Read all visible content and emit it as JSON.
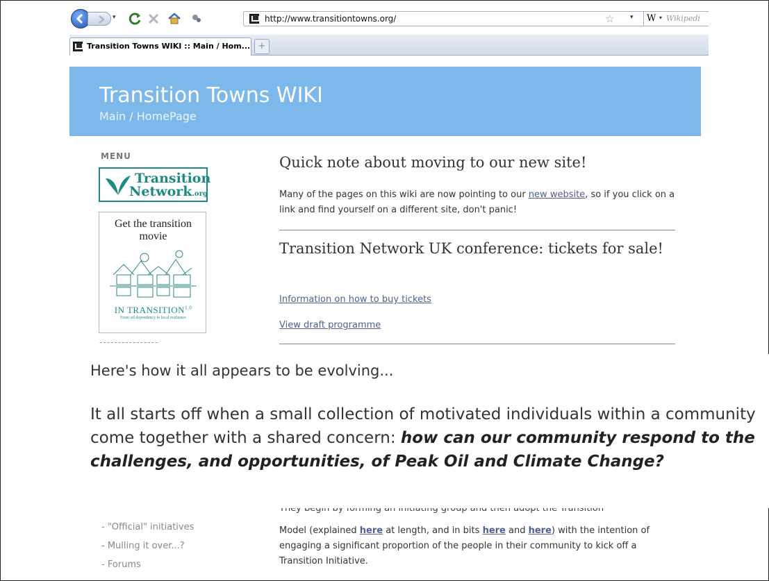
{
  "browser": {
    "url": "http://www.transitiontowns.org/",
    "tab_title": "Transition Towns WIKI :: Main / Hom...",
    "search_engine": "W",
    "search_placeholder": "Wikipedi",
    "newtab_symbol": "+"
  },
  "header": {
    "title": "Transition Towns WIKI",
    "subtitle": "Main / HomePage"
  },
  "sidebar": {
    "menu_label": "MENU",
    "logo_line1": "Transition",
    "logo_line2": "Network",
    "logo_suffix": ".org",
    "movie_title": "Get the transition movie",
    "movie_banner": "IN TRANSITION",
    "movie_version": "1.0",
    "movie_tagline": "From oil dependency to local resilience",
    "separator": "----------------",
    "links": [
      "- \"Official\" initiatives",
      "- Mulling it over...?",
      "- Forums"
    ]
  },
  "main": {
    "note_heading": "Quick note about moving to our new site!",
    "note_pre": "Many of the pages on this wiki are now pointing to our ",
    "note_link": "new website",
    "note_post": ", so if you click on a link and find yourself on a different site, don't panic!",
    "conf_heading": "Transition Network UK conference: tickets for sale!",
    "conf_link1": "Information on how to buy tickets",
    "conf_link2": "View draft programme",
    "zoom_line1": "Here's how it all appears to be evolving...",
    "zoom_line2_pre": "It all starts off when a small collection of motivated individuals within a community come together with a shared concern: ",
    "zoom_line2_bold": "how can our community respond to the challenges, and opportunities, of Peak Oil and Climate Change?",
    "partial_line": "They begin by forming an initiating group and then adopt the Transition",
    "body_p1": "Model (explained ",
    "body_link1": "here",
    "body_p2": " at length, and in bits ",
    "body_link2": "here",
    "body_p3": " and ",
    "body_link3": "here",
    "body_p4": ") with the intention of engaging a significant proportion of the people in their community to kick off a Transition Initiative."
  },
  "colors": {
    "banner": "#7db8eb",
    "link": "#4e5f92",
    "logo_green": "#1f8a80"
  }
}
